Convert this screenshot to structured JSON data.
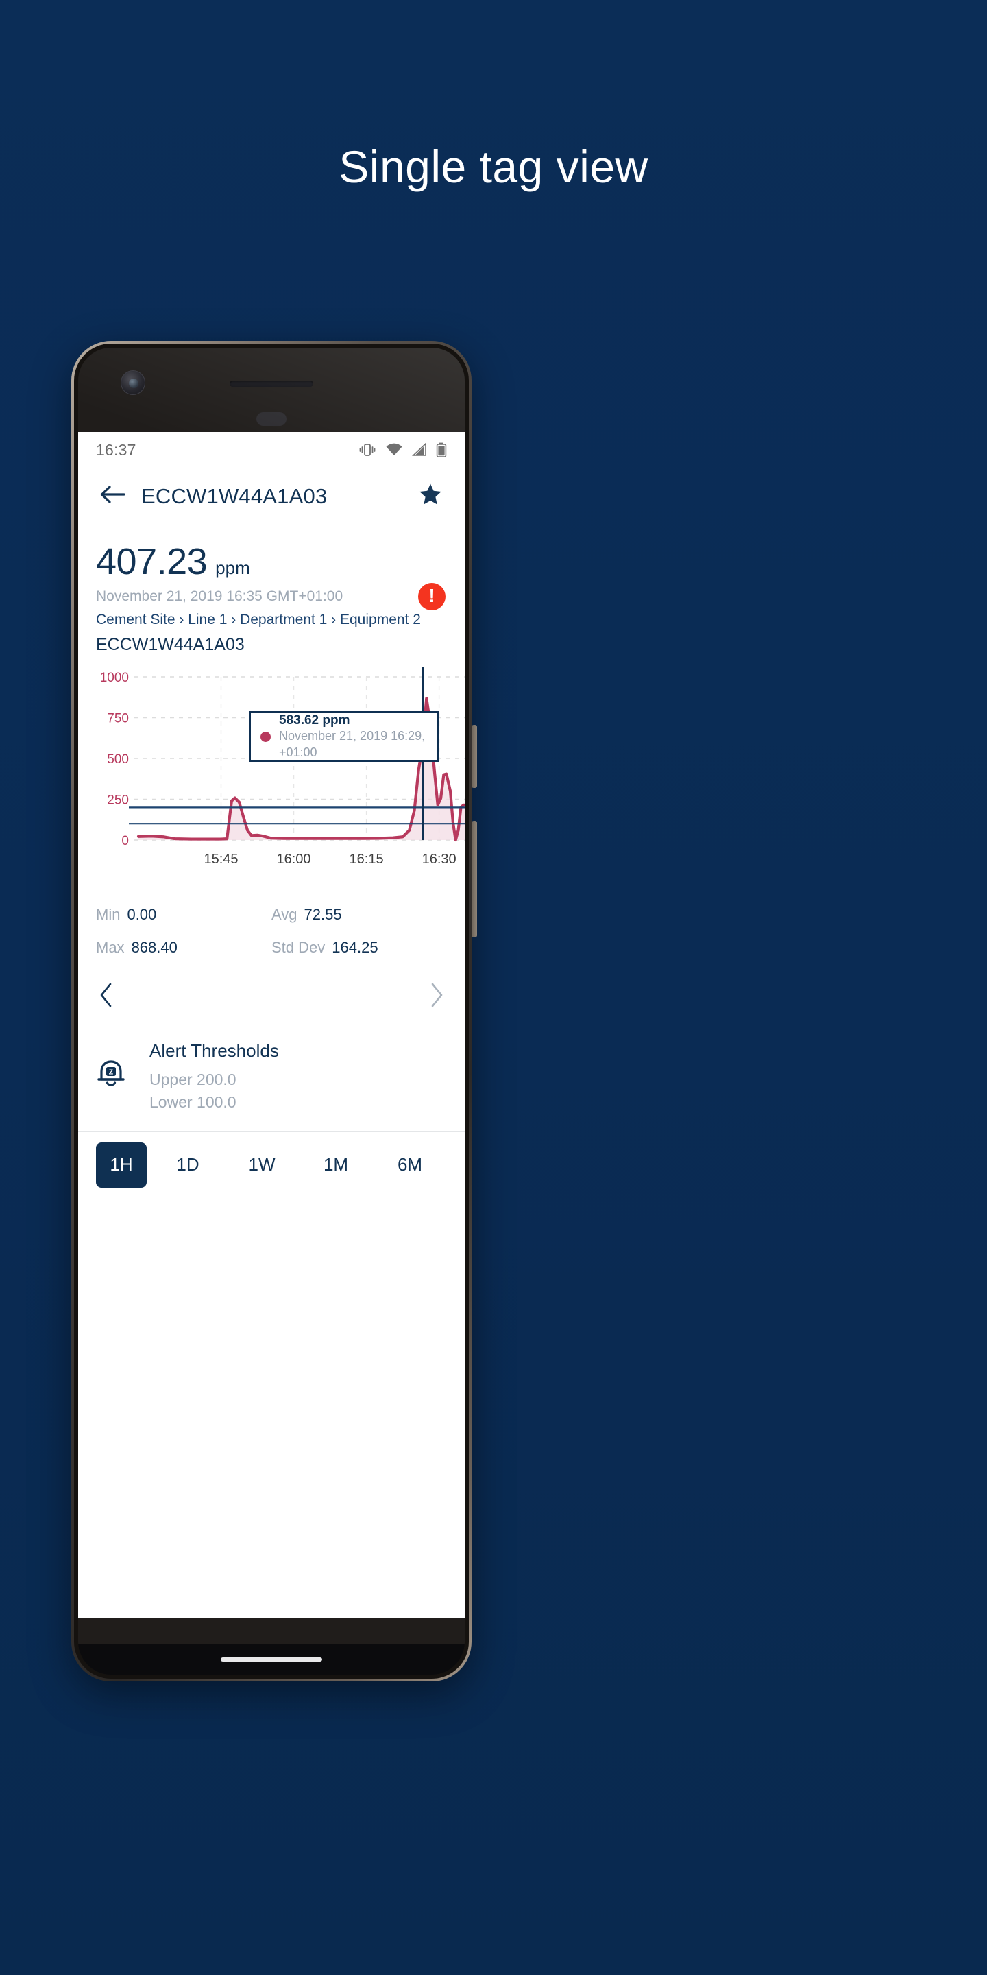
{
  "poster": {
    "headline": "Single tag view"
  },
  "status_bar": {
    "time": "16:37",
    "icons": [
      "vibrate-icon",
      "wifi-icon",
      "signal-icon",
      "battery-icon"
    ]
  },
  "app_bar": {
    "back_icon": "back-arrow-icon",
    "title": "ECCW1W44A1A03",
    "favorite_icon": "star-filled-icon"
  },
  "reading": {
    "value": "407.23",
    "unit": "ppm",
    "timestamp": "November 21, 2019 16:35 GMT+01:00",
    "breadcrumb": "Cement Site › Line 1 › Department 1 › Equipment 2",
    "tag_name": "ECCW1W44A1A03",
    "alert_badge": "!"
  },
  "tooltip": {
    "value": "583.62 ppm",
    "timestamp": "November 21, 2019 16:29, +01:00"
  },
  "stats": {
    "min_label": "Min",
    "min_value": "0.00",
    "avg_label": "Avg",
    "avg_value": "72.55",
    "max_label": "Max",
    "max_value": "868.40",
    "std_label": "Std Dev",
    "std_value": "164.25"
  },
  "pager": {
    "prev_icon": "chevron-left-icon",
    "next_icon": "chevron-right-icon"
  },
  "thresholds": {
    "icon": "bell-snooze-icon",
    "title": "Alert Thresholds",
    "upper": "Upper 200.0",
    "lower": "Lower 100.0"
  },
  "ranges": {
    "selected": "1H",
    "options": [
      "1H",
      "1D",
      "1W",
      "1M",
      "6M"
    ]
  },
  "colors": {
    "brand_navy": "#123354",
    "poster_bg": "#0b2d57",
    "series": "#b8395d",
    "series_fill": "#f3dbe3",
    "axis_label": "#b8395d",
    "threshold_line": "#1d4470",
    "alert_red": "#f4341f"
  },
  "chart_data": {
    "type": "area",
    "title": "",
    "xlabel": "",
    "ylabel": "",
    "unit": "ppm",
    "ylim": [
      0,
      1000
    ],
    "yticks": [
      0,
      250,
      500,
      750,
      1000
    ],
    "ytick_labels": [
      "0",
      "250",
      "500",
      "750",
      "1000"
    ],
    "xtick_labels": [
      "15:45",
      "16:00",
      "16:15",
      "16:30"
    ],
    "xtick_positions": [
      0.25,
      0.47,
      0.69,
      0.91
    ],
    "grid": true,
    "legend": "none",
    "threshold_lines": [
      {
        "name": "Upper",
        "value": 200
      },
      {
        "name": "Lower",
        "value": 100
      }
    ],
    "highlight_point": {
      "x_label": "16:29",
      "y": 583.62
    },
    "series": [
      {
        "name": "ECCW1W44A1A03",
        "color": "#b8395d",
        "points": [
          [
            0.0,
            22
          ],
          [
            0.04,
            24
          ],
          [
            0.075,
            20
          ],
          [
            0.11,
            8
          ],
          [
            0.16,
            6
          ],
          [
            0.21,
            6
          ],
          [
            0.25,
            6
          ],
          [
            0.268,
            8
          ],
          [
            0.282,
            240
          ],
          [
            0.292,
            258
          ],
          [
            0.305,
            232
          ],
          [
            0.318,
            140
          ],
          [
            0.33,
            60
          ],
          [
            0.342,
            28
          ],
          [
            0.36,
            30
          ],
          [
            0.378,
            24
          ],
          [
            0.4,
            12
          ],
          [
            0.44,
            10
          ],
          [
            0.5,
            10
          ],
          [
            0.56,
            10
          ],
          [
            0.62,
            10
          ],
          [
            0.68,
            10
          ],
          [
            0.73,
            11
          ],
          [
            0.77,
            14
          ],
          [
            0.8,
            20
          ],
          [
            0.82,
            60
          ],
          [
            0.835,
            180
          ],
          [
            0.848,
            430
          ],
          [
            0.86,
            583.62
          ],
          [
            0.872,
            868.4
          ],
          [
            0.884,
            700
          ],
          [
            0.896,
            420
          ],
          [
            0.906,
            215
          ],
          [
            0.915,
            255
          ],
          [
            0.924,
            400
          ],
          [
            0.932,
            405
          ],
          [
            0.944,
            300
          ],
          [
            0.952,
            110
          ],
          [
            0.96,
            0
          ],
          [
            0.968,
            60
          ],
          [
            0.976,
            200
          ],
          [
            0.984,
            215
          ],
          [
            1.0,
            212
          ]
        ]
      }
    ]
  }
}
